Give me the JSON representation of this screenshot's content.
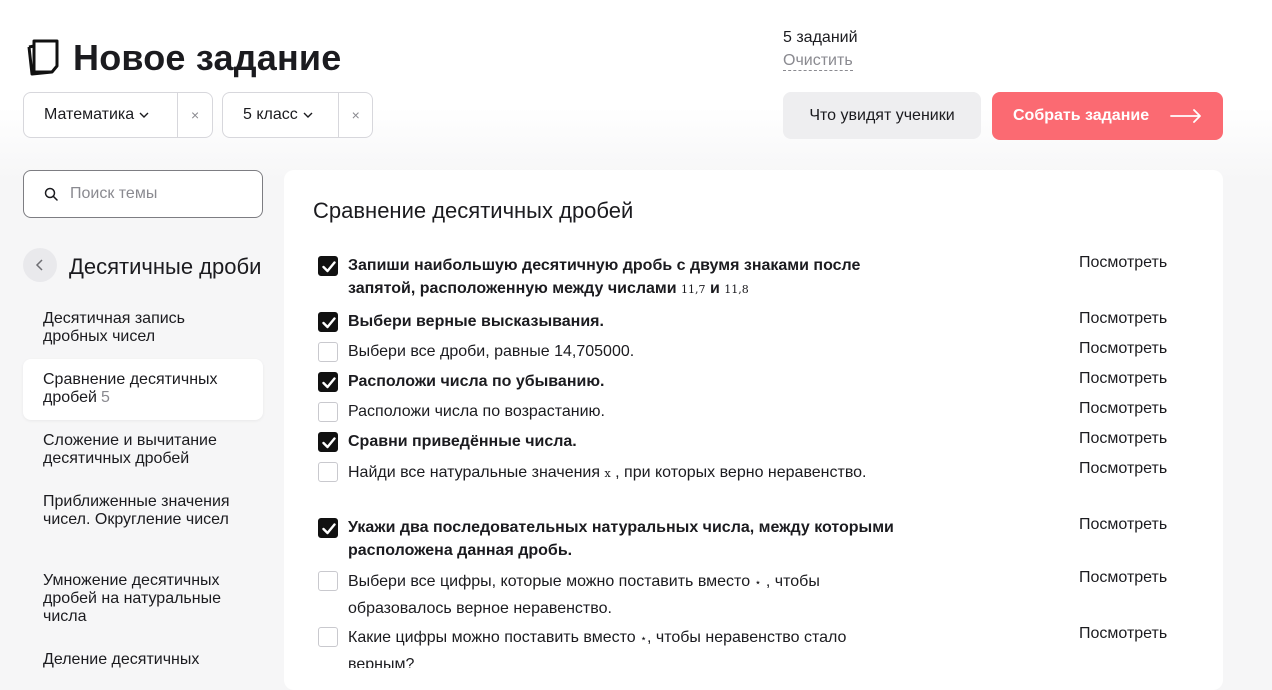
{
  "header": {
    "title": "Новое задание",
    "task_count": "5 заданий",
    "clear_label": "Очистить",
    "preview_label": "Что увидят ученики",
    "build_label": "Собрать задание"
  },
  "filters": [
    {
      "value": "Математика",
      "clear": "×"
    },
    {
      "value": "5 класс",
      "clear": "×"
    }
  ],
  "sidebar": {
    "search_placeholder": "Поиск темы",
    "section_title": "Десятичные дроби",
    "topics": [
      {
        "label": "Десятичная запись дробных чисел",
        "count": ""
      },
      {
        "label": "Сравнение десятичных дробей",
        "count": "5"
      },
      {
        "label": "Сложение и вычитание десятичных дробей",
        "count": ""
      },
      {
        "label": "Приближенные значения чисел. Округление чисел",
        "count": ""
      },
      {
        "label": "Умножение десятичных дробей на натуральные числа",
        "count": ""
      },
      {
        "label": "Деление десятичных",
        "count": ""
      }
    ]
  },
  "main": {
    "title": "Сравнение десятичных дробей",
    "view_label": "Посмотреть",
    "tasks": [
      {
        "checked": true,
        "text": "Запиши наибольшую десятичную дробь с двумя знаками после запятой, расположенную между числами",
        "math1": "11,7",
        "joiner": "и",
        "math2": "11,8"
      },
      {
        "checked": true,
        "text": "Выбери верные высказывания."
      },
      {
        "checked": false,
        "text": "Выбери все дроби, равные 14,705000."
      },
      {
        "checked": true,
        "text": "Расположи числа по убыванию."
      },
      {
        "checked": false,
        "text": "Расположи числа по возрастанию."
      },
      {
        "checked": true,
        "text": "Сравни приведённые числа."
      },
      {
        "checked": false,
        "text_a": "Найди все натуральные значения",
        "math": "x",
        "text_b": ", при которых верно неравенство."
      },
      {
        "checked": true,
        "text": "Укажи два последовательных натуральных числа, между которыми расположена данная дробь."
      },
      {
        "checked": false,
        "text_a": "Выбери все цифры, которые можно поставить вместо",
        "math": "⋆",
        "text_b": ", чтобы образовалось верное неравенство."
      },
      {
        "checked": false,
        "text_a": "Какие цифры можно поставить вместо",
        "math": "⋆",
        "text_b": ", чтобы неравенство стало верным?"
      }
    ]
  },
  "colors": {
    "accent": "#fb6a72",
    "check": "#111111",
    "muted": "#8a8a90"
  }
}
